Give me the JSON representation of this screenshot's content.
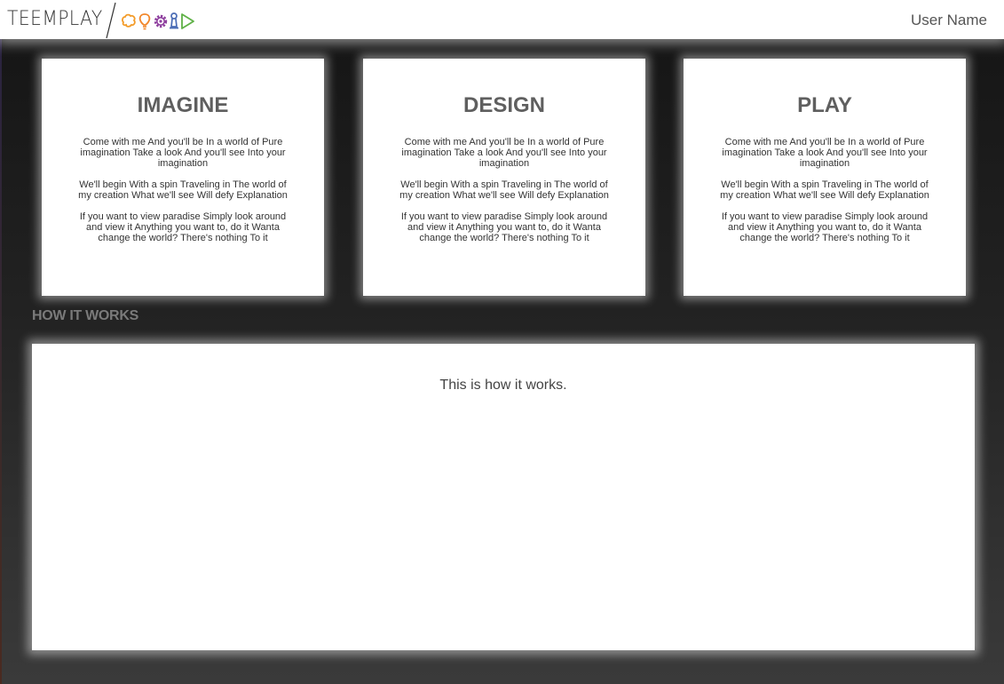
{
  "header": {
    "logo_text": "TEEMPLAY",
    "user_name": "User Name"
  },
  "logo_icons": [
    "brain-icon",
    "lightbulb-icon",
    "gear-icon",
    "pawn-icon",
    "play-icon"
  ],
  "colors": {
    "brain": "#f39c2a",
    "lightbulb": "#f2872a",
    "gear": "#8e3f9e",
    "pawn": "#4a6cb5",
    "play": "#5fb147",
    "heading": "#5f5f5f",
    "section_title": "#7a7a7a"
  },
  "cards": [
    {
      "title": "IMAGINE",
      "paragraphs": [
        "Come with me And you'll be In a world of Pure imagination Take a look And you'll see Into your imagination",
        "We'll begin With a spin Traveling in The world of my creation What we'll see Will defy Explanation",
        "If you want to view paradise Simply look around and view it Anything you want to, do it Wanta change the world? There's nothing To it"
      ]
    },
    {
      "title": "DESIGN",
      "paragraphs": [
        "Come with me And you'll be In a world of Pure imagination Take a look And you'll see Into your imagination",
        "We'll begin With a spin Traveling in The world of my creation What we'll see Will defy Explanation",
        "If you want to view paradise Simply look around and view it Anything you want to, do it Wanta change the world? There's nothing To it"
      ]
    },
    {
      "title": "PLAY",
      "paragraphs": [
        "Come with me And you'll be In a world of Pure imagination Take a look And you'll see Into your imagination",
        "We'll begin With a spin Traveling in The world of my creation What we'll see Will defy Explanation",
        "If you want to view paradise Simply look around and view it Anything you want to, do it Wanta change the world? There's nothing To it"
      ]
    }
  ],
  "how_it_works": {
    "title": "HOW IT WORKS",
    "text": "This is how it works."
  }
}
